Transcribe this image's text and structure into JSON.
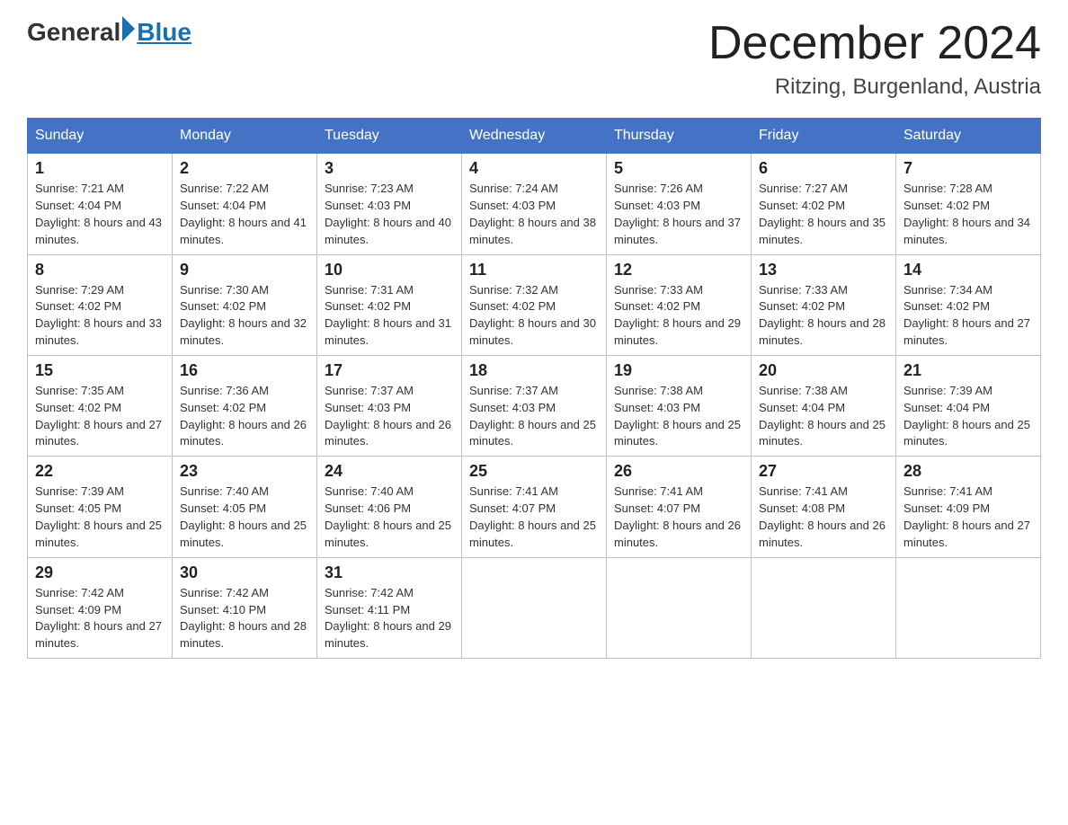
{
  "logo": {
    "general": "General",
    "blue": "Blue"
  },
  "header": {
    "month_year": "December 2024",
    "location": "Ritzing, Burgenland, Austria"
  },
  "weekdays": [
    "Sunday",
    "Monday",
    "Tuesday",
    "Wednesday",
    "Thursday",
    "Friday",
    "Saturday"
  ],
  "weeks": [
    [
      {
        "day": "1",
        "sunrise": "7:21 AM",
        "sunset": "4:04 PM",
        "daylight": "8 hours and 43 minutes."
      },
      {
        "day": "2",
        "sunrise": "7:22 AM",
        "sunset": "4:04 PM",
        "daylight": "8 hours and 41 minutes."
      },
      {
        "day": "3",
        "sunrise": "7:23 AM",
        "sunset": "4:03 PM",
        "daylight": "8 hours and 40 minutes."
      },
      {
        "day": "4",
        "sunrise": "7:24 AM",
        "sunset": "4:03 PM",
        "daylight": "8 hours and 38 minutes."
      },
      {
        "day": "5",
        "sunrise": "7:26 AM",
        "sunset": "4:03 PM",
        "daylight": "8 hours and 37 minutes."
      },
      {
        "day": "6",
        "sunrise": "7:27 AM",
        "sunset": "4:02 PM",
        "daylight": "8 hours and 35 minutes."
      },
      {
        "day": "7",
        "sunrise": "7:28 AM",
        "sunset": "4:02 PM",
        "daylight": "8 hours and 34 minutes."
      }
    ],
    [
      {
        "day": "8",
        "sunrise": "7:29 AM",
        "sunset": "4:02 PM",
        "daylight": "8 hours and 33 minutes."
      },
      {
        "day": "9",
        "sunrise": "7:30 AM",
        "sunset": "4:02 PM",
        "daylight": "8 hours and 32 minutes."
      },
      {
        "day": "10",
        "sunrise": "7:31 AM",
        "sunset": "4:02 PM",
        "daylight": "8 hours and 31 minutes."
      },
      {
        "day": "11",
        "sunrise": "7:32 AM",
        "sunset": "4:02 PM",
        "daylight": "8 hours and 30 minutes."
      },
      {
        "day": "12",
        "sunrise": "7:33 AM",
        "sunset": "4:02 PM",
        "daylight": "8 hours and 29 minutes."
      },
      {
        "day": "13",
        "sunrise": "7:33 AM",
        "sunset": "4:02 PM",
        "daylight": "8 hours and 28 minutes."
      },
      {
        "day": "14",
        "sunrise": "7:34 AM",
        "sunset": "4:02 PM",
        "daylight": "8 hours and 27 minutes."
      }
    ],
    [
      {
        "day": "15",
        "sunrise": "7:35 AM",
        "sunset": "4:02 PM",
        "daylight": "8 hours and 27 minutes."
      },
      {
        "day": "16",
        "sunrise": "7:36 AM",
        "sunset": "4:02 PM",
        "daylight": "8 hours and 26 minutes."
      },
      {
        "day": "17",
        "sunrise": "7:37 AM",
        "sunset": "4:03 PM",
        "daylight": "8 hours and 26 minutes."
      },
      {
        "day": "18",
        "sunrise": "7:37 AM",
        "sunset": "4:03 PM",
        "daylight": "8 hours and 25 minutes."
      },
      {
        "day": "19",
        "sunrise": "7:38 AM",
        "sunset": "4:03 PM",
        "daylight": "8 hours and 25 minutes."
      },
      {
        "day": "20",
        "sunrise": "7:38 AM",
        "sunset": "4:04 PM",
        "daylight": "8 hours and 25 minutes."
      },
      {
        "day": "21",
        "sunrise": "7:39 AM",
        "sunset": "4:04 PM",
        "daylight": "8 hours and 25 minutes."
      }
    ],
    [
      {
        "day": "22",
        "sunrise": "7:39 AM",
        "sunset": "4:05 PM",
        "daylight": "8 hours and 25 minutes."
      },
      {
        "day": "23",
        "sunrise": "7:40 AM",
        "sunset": "4:05 PM",
        "daylight": "8 hours and 25 minutes."
      },
      {
        "day": "24",
        "sunrise": "7:40 AM",
        "sunset": "4:06 PM",
        "daylight": "8 hours and 25 minutes."
      },
      {
        "day": "25",
        "sunrise": "7:41 AM",
        "sunset": "4:07 PM",
        "daylight": "8 hours and 25 minutes."
      },
      {
        "day": "26",
        "sunrise": "7:41 AM",
        "sunset": "4:07 PM",
        "daylight": "8 hours and 26 minutes."
      },
      {
        "day": "27",
        "sunrise": "7:41 AM",
        "sunset": "4:08 PM",
        "daylight": "8 hours and 26 minutes."
      },
      {
        "day": "28",
        "sunrise": "7:41 AM",
        "sunset": "4:09 PM",
        "daylight": "8 hours and 27 minutes."
      }
    ],
    [
      {
        "day": "29",
        "sunrise": "7:42 AM",
        "sunset": "4:09 PM",
        "daylight": "8 hours and 27 minutes."
      },
      {
        "day": "30",
        "sunrise": "7:42 AM",
        "sunset": "4:10 PM",
        "daylight": "8 hours and 28 minutes."
      },
      {
        "day": "31",
        "sunrise": "7:42 AM",
        "sunset": "4:11 PM",
        "daylight": "8 hours and 29 minutes."
      },
      null,
      null,
      null,
      null
    ]
  ]
}
